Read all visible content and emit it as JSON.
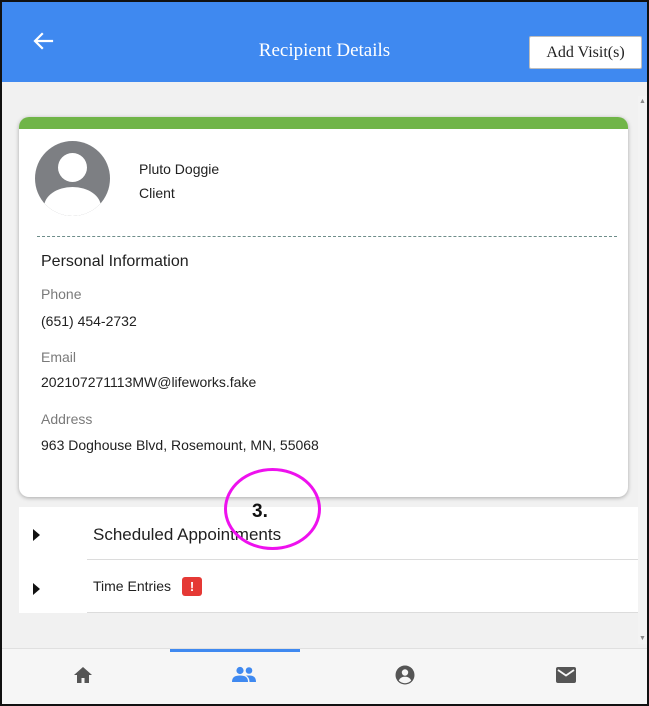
{
  "header": {
    "title": "Recipient Details",
    "add_visit_label": "Add Visit(s)"
  },
  "profile": {
    "name": "Pluto Doggie",
    "role": "Client"
  },
  "personal_info": {
    "title": "Personal Information",
    "phone_label": "Phone",
    "phone_value": "(651) 454-2732",
    "email_label": "Email",
    "email_value": "202107271113MW@lifeworks.fake",
    "address_label": "Address",
    "address_value": "963 Doghouse Blvd, Rosemount, MN, 55068"
  },
  "accordion": {
    "scheduled_label": "Scheduled Appointments",
    "time_entries_label": "Time Entries",
    "alert_badge": "!"
  },
  "annotation": {
    "label": "3."
  },
  "colors": {
    "header": "#3f89f0",
    "card_accent": "#70b548",
    "alert": "#e53935",
    "annotation": "#ee11ee",
    "nav_icon_active": "#3f89f0",
    "nav_icon": "#555555"
  },
  "bottom_nav": {
    "items": [
      {
        "icon": "home-icon",
        "active": false
      },
      {
        "icon": "people-icon",
        "active": true
      },
      {
        "icon": "account-circle-icon",
        "active": false
      },
      {
        "icon": "mail-icon",
        "active": false
      }
    ]
  }
}
